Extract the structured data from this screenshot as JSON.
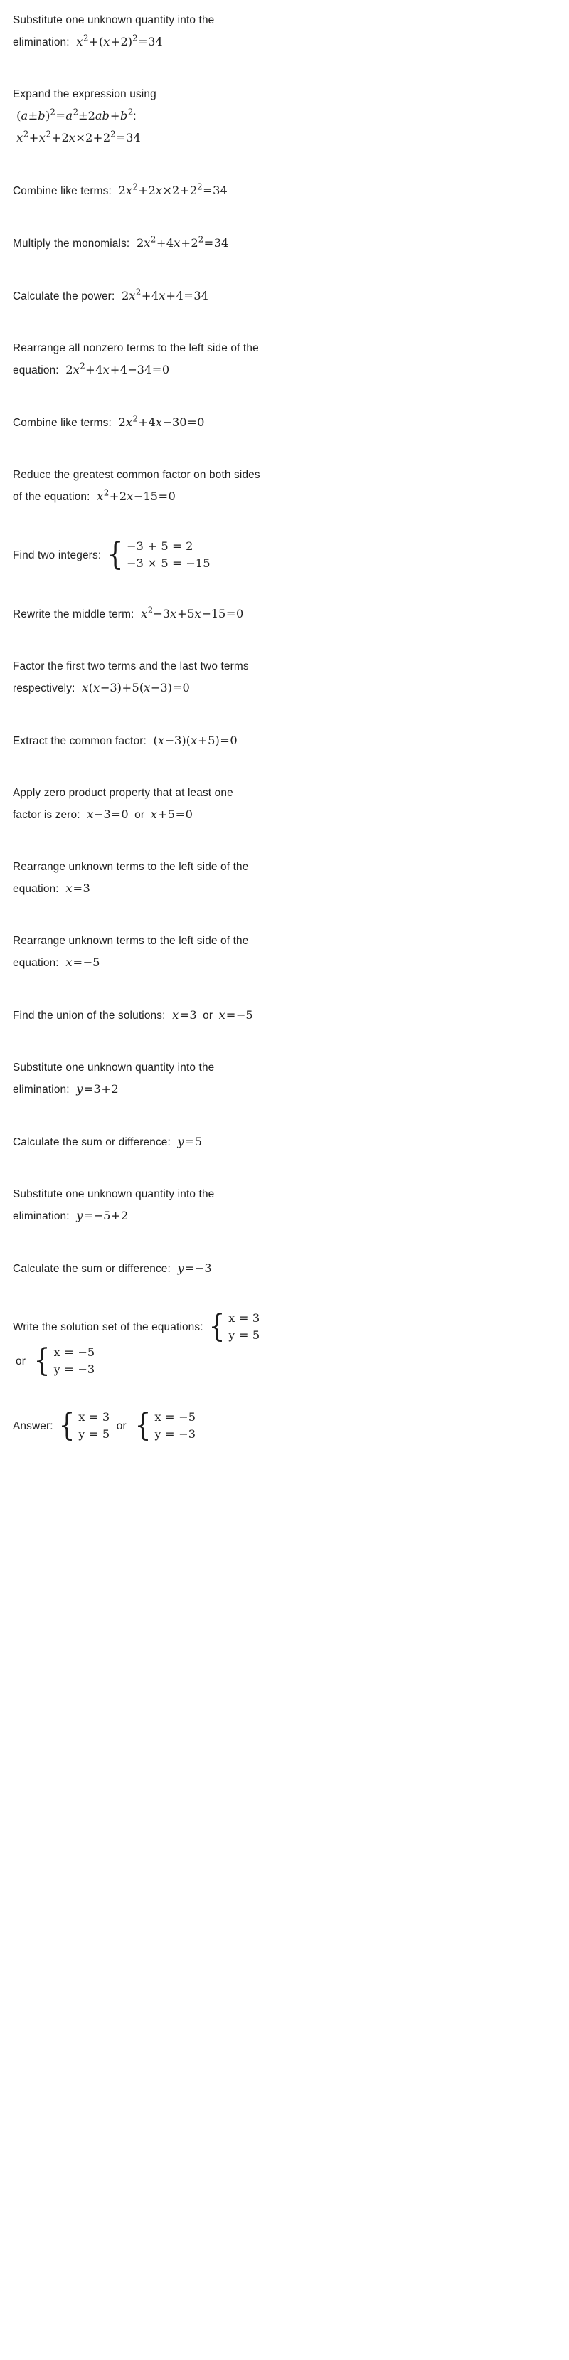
{
  "document": {
    "type": "math-solution-steps",
    "topic": "Solving a system of equations by substitution and factoring",
    "background_color": "#ffffff",
    "text_color": "#1f1f1f"
  },
  "steps": [
    {
      "id": "substitute-1",
      "label": "Substitute one unknown quantity into the elimination:",
      "math": "x^2+(x+2)^2=34"
    },
    {
      "id": "expand",
      "label": "Expand the expression using",
      "label_math": "(a±b)^2=a^2±2ab+b^2",
      "label_suffix": ":",
      "math": "x^2+x^2+2x×2+2^2=34"
    },
    {
      "id": "combine-1",
      "label": "Combine like terms:",
      "math": "2x^2+2x×2+2^2=34"
    },
    {
      "id": "multiply-monomials",
      "label": "Multiply the monomials:",
      "math": "2x^2+4x+2^2=34"
    },
    {
      "id": "calculate-power",
      "label": "Calculate the power:",
      "math": "2x^2+4x+4=34"
    },
    {
      "id": "rearrange-1",
      "label": "Rearrange all nonzero terms to the left side of the equation:",
      "math": "2x^2+4x+4−34=0"
    },
    {
      "id": "combine-2",
      "label": "Combine like terms:",
      "math": "2x^2+4x−30=0"
    },
    {
      "id": "reduce-gcf",
      "label": "Reduce the greatest common factor on both sides of the equation:",
      "math": "x^2+2x−15=0"
    },
    {
      "id": "find-two-integers",
      "label": "Find two integers:",
      "system": {
        "row1": "−3 + 5 = 2",
        "row2": "−3 × 5 = −15"
      }
    },
    {
      "id": "rewrite-middle-term",
      "label": "Rewrite the middle term:",
      "math": "x^2−3x+5x−15=0"
    },
    {
      "id": "factor-pairs",
      "label": "Factor the first two terms and the last two terms respectively:",
      "math": "x(x−3)+5(x−3)=0"
    },
    {
      "id": "extract-common-factor",
      "label": "Extract the common factor:",
      "math": "(x−3)(x+5)=0"
    },
    {
      "id": "zero-product",
      "label": "Apply zero product property that at least one factor is zero:",
      "math_left": "x−3=0",
      "connector": "or",
      "math_right": "x+5=0"
    },
    {
      "id": "rearrange-x-3",
      "label": "Rearrange unknown terms to the left side of the equation:",
      "math": "x=3"
    },
    {
      "id": "rearrange-x-neg5",
      "label": "Rearrange unknown terms to the left side of the equation:",
      "math": "x=−5"
    },
    {
      "id": "union-solutions",
      "label": "Find the union of the solutions:",
      "math_left": "x=3",
      "connector": "or",
      "math_right": "x=−5"
    },
    {
      "id": "substitute-2",
      "label": "Substitute one unknown quantity into the elimination:",
      "math": "y=3+2"
    },
    {
      "id": "sum-1",
      "label": "Calculate the sum or difference:",
      "math": "y=5"
    },
    {
      "id": "substitute-3",
      "label": "Substitute one unknown quantity into the elimination:",
      "math": "y=−5+2"
    },
    {
      "id": "sum-2",
      "label": "Calculate the sum or difference:",
      "math": "y=−3"
    }
  ],
  "solution_set": {
    "label": "Write the solution set of the equations:",
    "connector": "or",
    "set_a": {
      "row1": "x = 3",
      "row2": "y = 5"
    },
    "set_b": {
      "row1": "x = −5",
      "row2": "y = −3"
    }
  },
  "answer": {
    "label": "Answer:",
    "connector": "or",
    "set_a": {
      "row1": "x = 3",
      "row2": "y = 5"
    },
    "set_b": {
      "row1": "x = −5",
      "row2": "y = −3"
    }
  }
}
